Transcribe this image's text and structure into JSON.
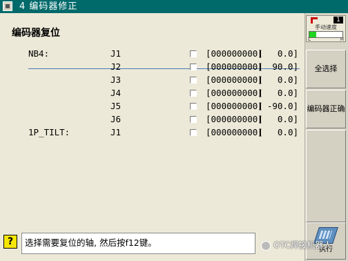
{
  "window": {
    "title": "4 编码器修正"
  },
  "section_title": "编码器复位",
  "rows": [
    {
      "group": "NB4:",
      "axis": "J1",
      "counter": "[000000000]",
      "bracket": "[",
      "angle": "0.0]"
    },
    {
      "group": "",
      "axis": "J2",
      "counter": "[000000000]",
      "bracket": "[",
      "angle": "90.0]"
    },
    {
      "group": "",
      "axis": "J3",
      "counter": "[000000000]",
      "bracket": "[",
      "angle": "0.0]"
    },
    {
      "group": "",
      "axis": "J4",
      "counter": "[000000000]",
      "bracket": "[",
      "angle": "0.0]"
    },
    {
      "group": "",
      "axis": "J5",
      "counter": "[000000000]",
      "bracket": "[",
      "angle": "-90.0]"
    },
    {
      "group": "",
      "axis": "J6",
      "counter": "[000000000]",
      "bracket": "[",
      "angle": "0.0]"
    },
    {
      "group": "1P_TILT:",
      "axis": "J1",
      "counter": "[000000000]",
      "bracket": "[",
      "angle": "0.0]"
    }
  ],
  "speed": {
    "level": "1",
    "label": "手动速度",
    "low": "L",
    "high": "H",
    "fill_fraction": 0.2
  },
  "buttons": {
    "select_all": "全选择",
    "encoder": "编码器正确",
    "exec": "执行"
  },
  "status": {
    "message": "选择需要复位的轴, 然后按f12键。"
  },
  "help_icon_glyph": "?",
  "watermark": "OTC焊接机器人",
  "colors": {
    "title_bar": "#006a6b",
    "panel": "#ece9d8",
    "divider": "#4a78b5"
  }
}
